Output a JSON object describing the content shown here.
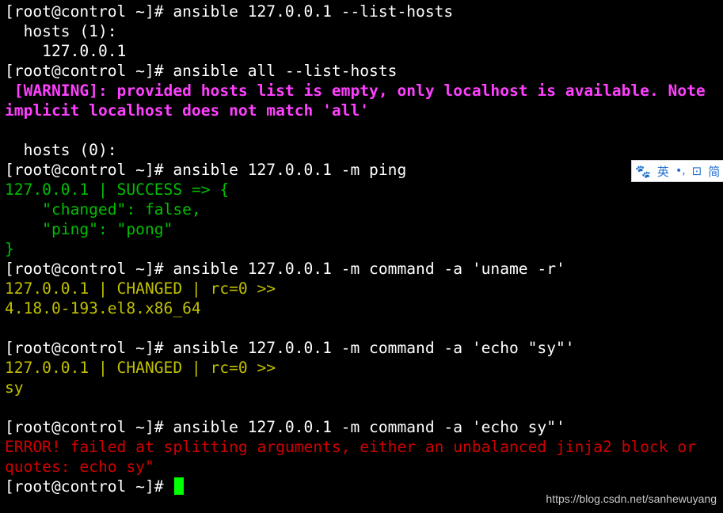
{
  "terminal": {
    "lines": [
      {
        "text": "[root@control ~]# ansible 127.0.0.1 --list-hosts",
        "color": "white"
      },
      {
        "text": "  hosts (1):",
        "color": "white"
      },
      {
        "text": "    127.0.0.1",
        "color": "white"
      },
      {
        "text": "[root@control ~]# ansible all --list-hosts",
        "color": "white"
      },
      {
        "text": " [WARNING]: provided hosts list is empty, only localhost is available. Note",
        "color": "magenta"
      },
      {
        "text": "implicit localhost does not match 'all'",
        "color": "magenta"
      },
      {
        "text": "",
        "color": "white"
      },
      {
        "text": "  hosts (0):",
        "color": "white"
      },
      {
        "text": "[root@control ~]# ansible 127.0.0.1 -m ping",
        "color": "white"
      },
      {
        "text": "127.0.0.1 | SUCCESS => {",
        "color": "green"
      },
      {
        "text": "    \"changed\": false,",
        "color": "green"
      },
      {
        "text": "    \"ping\": \"pong\"",
        "color": "green"
      },
      {
        "text": "}",
        "color": "green"
      },
      {
        "text": "[root@control ~]# ansible 127.0.0.1 -m command -a 'uname -r'",
        "color": "white"
      },
      {
        "text": "127.0.0.1 | CHANGED | rc=0 >>",
        "color": "yellow"
      },
      {
        "text": "4.18.0-193.el8.x86_64",
        "color": "yellow"
      },
      {
        "text": "",
        "color": "white"
      },
      {
        "text": "[root@control ~]# ansible 127.0.0.1 -m command -a 'echo \"sy\"'",
        "color": "white"
      },
      {
        "text": "127.0.0.1 | CHANGED | rc=0 >>",
        "color": "yellow"
      },
      {
        "text": "sy",
        "color": "yellow"
      },
      {
        "text": "",
        "color": "white"
      },
      {
        "text": "[root@control ~]# ansible 127.0.0.1 -m command -a 'echo sy\"'",
        "color": "white"
      },
      {
        "text": "ERROR! failed at splitting arguments, either an unbalanced jinja2 block or",
        "color": "red"
      },
      {
        "text": "quotes: echo sy\"",
        "color": "red"
      }
    ],
    "prompt": "[root@control ~]# "
  },
  "ime": {
    "icon": "paw-icon",
    "lang": "英",
    "punct": "•,",
    "extra1": "⊡",
    "extra2": "简"
  },
  "watermark": "https://blog.csdn.net/sanhewuyang",
  "colors": {
    "background": "#000000",
    "white": "#ffffff",
    "green": "#00c000",
    "yellow": "#c0c000",
    "red": "#d00000",
    "magenta": "#ff40ff",
    "cursor": "#00ff00"
  }
}
